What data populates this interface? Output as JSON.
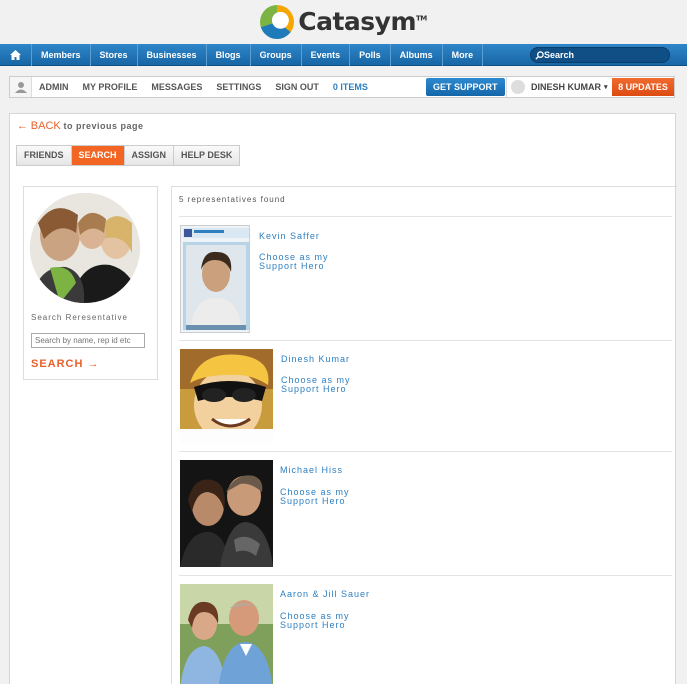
{
  "brand": {
    "name": "Catasym",
    "tm": "TM"
  },
  "nav": {
    "items": [
      "Members",
      "Stores",
      "Businesses",
      "Blogs",
      "Groups",
      "Events",
      "Polls",
      "Albums",
      "More"
    ],
    "search_placeholder": "Search"
  },
  "userbar": {
    "links": [
      "ADMIN",
      "MY PROFILE",
      "MESSAGES",
      "SETTINGS",
      "SIGN OUT"
    ],
    "items_count": "0 ITEMS",
    "get_support": "GET SUPPORT",
    "user_name": "DINESH KUMAR",
    "updates": "8 UPDATES"
  },
  "back": {
    "arrow": "←",
    "label": "BACK",
    "rest": "to previous page"
  },
  "tabs": [
    "FRIENDS",
    "SEARCH",
    "ASSIGN",
    "HELP DESK"
  ],
  "search_panel": {
    "label": "Search Reresentative",
    "placeholder": "Search by name, rep id etc",
    "button": "SEARCH →"
  },
  "results": {
    "summary": "5 representatives found",
    "reps": [
      {
        "name": "Kevin Saffer",
        "choose": [
          "Choose as my",
          "Support Hero"
        ]
      },
      {
        "name": "Dinesh Kumar",
        "choose": [
          "Choose as my",
          "Support Hero"
        ]
      },
      {
        "name": "Michael Hiss",
        "choose": [
          "Choose as my",
          "Support Hero"
        ]
      },
      {
        "name": "Aaron & Jill Sauer",
        "choose": [
          "Choose as my",
          "Support Hero"
        ]
      }
    ]
  },
  "colors": {
    "accent": "#f26522",
    "link": "#2d7fc0",
    "nav": "#1f76b8"
  }
}
